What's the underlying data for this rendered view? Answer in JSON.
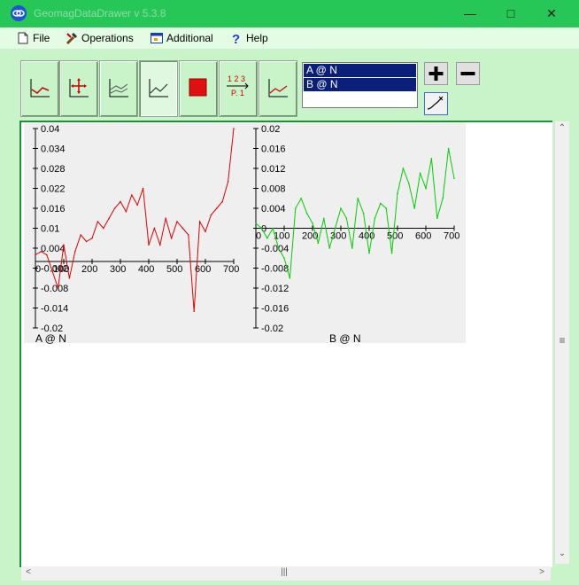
{
  "window": {
    "title": "GeomagDataDrawer v 5.3.8",
    "minimize_icon": "minimize-icon",
    "maximize_icon": "maximize-icon",
    "close_icon": "close-icon"
  },
  "menu": [
    {
      "label": "File",
      "icon": "file-icon"
    },
    {
      "label": "Operations",
      "icon": "tools-icon"
    },
    {
      "label": "Additional",
      "icon": "window-icon"
    },
    {
      "label": "Help",
      "icon": "help-icon"
    }
  ],
  "toolbar": {
    "buttons": [
      {
        "name": "plot-axes-button",
        "icon": "axes-icon"
      },
      {
        "name": "move-plot-button",
        "icon": "move-axes-icon"
      },
      {
        "name": "multi-plot-button",
        "icon": "multi-line-icon"
      },
      {
        "name": "line-plot-button",
        "icon": "line-chart-icon",
        "pressed": true
      },
      {
        "name": "fill-color-button",
        "icon": "red-square-icon"
      },
      {
        "name": "page-number-button",
        "icon": "page-number-icon",
        "text_top": "1 2 3",
        "text_bottom": "P. 1"
      },
      {
        "name": "line-style-button",
        "icon": "line-chart-red-icon"
      }
    ],
    "series_list": [
      "A @ N",
      "B @ N"
    ],
    "add_label": "+",
    "remove_label": "−"
  },
  "colors": {
    "series_a": "#e00000",
    "series_b": "#00d000",
    "title_bar": "#26c657",
    "selection": "#0a1f7a"
  },
  "chart_data": [
    {
      "type": "line",
      "series_label": "A @ N",
      "xlim": [
        0,
        700
      ],
      "ylim": [
        -0.02,
        0.04
      ],
      "x_ticks": [
        "0",
        "100",
        "200",
        "300",
        "400",
        "500",
        "600",
        "700"
      ],
      "y_ticks": [
        "0.04",
        "0.034",
        "0.028",
        "0.022",
        "0.016",
        "0.01",
        "0.004",
        "-0.002",
        "-0.008",
        "-0.014",
        "-0.02"
      ],
      "x": [
        0,
        20,
        40,
        60,
        80,
        100,
        120,
        140,
        160,
        180,
        200,
        220,
        240,
        260,
        280,
        300,
        320,
        340,
        360,
        380,
        400,
        420,
        440,
        460,
        480,
        500,
        520,
        540,
        560,
        580,
        600,
        620,
        640,
        660,
        680,
        700
      ],
      "y": [
        0.002,
        0.003,
        0.002,
        -0.003,
        -0.008,
        0.005,
        -0.005,
        0.003,
        0.008,
        0.006,
        0.007,
        0.012,
        0.01,
        0.013,
        0.016,
        0.018,
        0.015,
        0.02,
        0.017,
        0.022,
        0.005,
        0.01,
        0.005,
        0.013,
        0.007,
        0.012,
        0.01,
        0.008,
        -0.015,
        0.012,
        0.009,
        0.014,
        0.016,
        0.018,
        0.024,
        0.04
      ]
    },
    {
      "type": "line",
      "series_label": "B @ N",
      "xlim": [
        0,
        700
      ],
      "ylim": [
        -0.02,
        0.02
      ],
      "x_ticks": [
        "0",
        "100",
        "200",
        "300",
        "400",
        "500",
        "600",
        "700"
      ],
      "y_ticks": [
        "0.02",
        "0.016",
        "0.012",
        "0.008",
        "0.004",
        "0",
        "-0.004",
        "-0.008",
        "-0.012",
        "-0.016",
        "-0.02"
      ],
      "x": [
        0,
        20,
        40,
        60,
        80,
        100,
        120,
        140,
        160,
        180,
        200,
        220,
        240,
        260,
        280,
        300,
        320,
        340,
        360,
        380,
        400,
        420,
        440,
        460,
        480,
        500,
        520,
        540,
        560,
        580,
        600,
        620,
        640,
        660,
        680,
        700
      ],
      "y": [
        0.001,
        0.0,
        -0.002,
        0.0,
        -0.004,
        -0.006,
        -0.01,
        0.004,
        0.006,
        0.003,
        0.001,
        -0.003,
        0.002,
        -0.004,
        0.0,
        0.004,
        0.002,
        -0.004,
        0.006,
        0.003,
        -0.005,
        0.002,
        0.005,
        0.004,
        -0.005,
        0.007,
        0.012,
        0.009,
        0.004,
        0.011,
        0.008,
        0.014,
        0.002,
        0.006,
        0.016,
        0.01
      ]
    }
  ]
}
